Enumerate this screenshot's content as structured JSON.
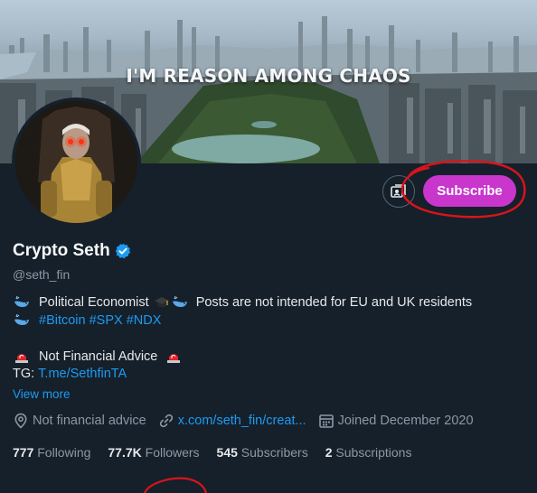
{
  "banner": {
    "caption": "I'M REASON AMONG CHAOS"
  },
  "profile": {
    "display_name": "Crypto Seth",
    "handle": "@seth_fin",
    "bio": {
      "line1_text": "Political Economist",
      "line1_posts": "Posts are not intended for EU and UK residents",
      "hashtags": [
        "#Bitcoin",
        "#SPX",
        "#NDX"
      ],
      "line3_text": "Not Financial Advice",
      "tg_label": "TG:",
      "tg_link": "T.me/SethfinTA"
    },
    "view_more": "View more",
    "location": "Not financial advice",
    "website": "x.com/seth_fin/creat...",
    "joined": "Joined December 2020"
  },
  "actions": {
    "subscribe_label": "Subscribe"
  },
  "stats": [
    {
      "value": "777",
      "label": "Following"
    },
    {
      "value": "77.7K",
      "label": "Followers"
    },
    {
      "value": "545",
      "label": "Subscribers"
    },
    {
      "value": "2",
      "label": "Subscriptions"
    }
  ],
  "colors": {
    "background": "#15202b",
    "subscribe": "#c936cc",
    "link": "#1d9bf0",
    "annotation": "#d8141c",
    "muted": "#8b98a5"
  },
  "icons": [
    "verified-badge-icon",
    "whale-icon",
    "graduation-cap-icon",
    "siren-icon",
    "location-pin-icon",
    "link-icon",
    "calendar-icon",
    "subscriptions-icon"
  ]
}
